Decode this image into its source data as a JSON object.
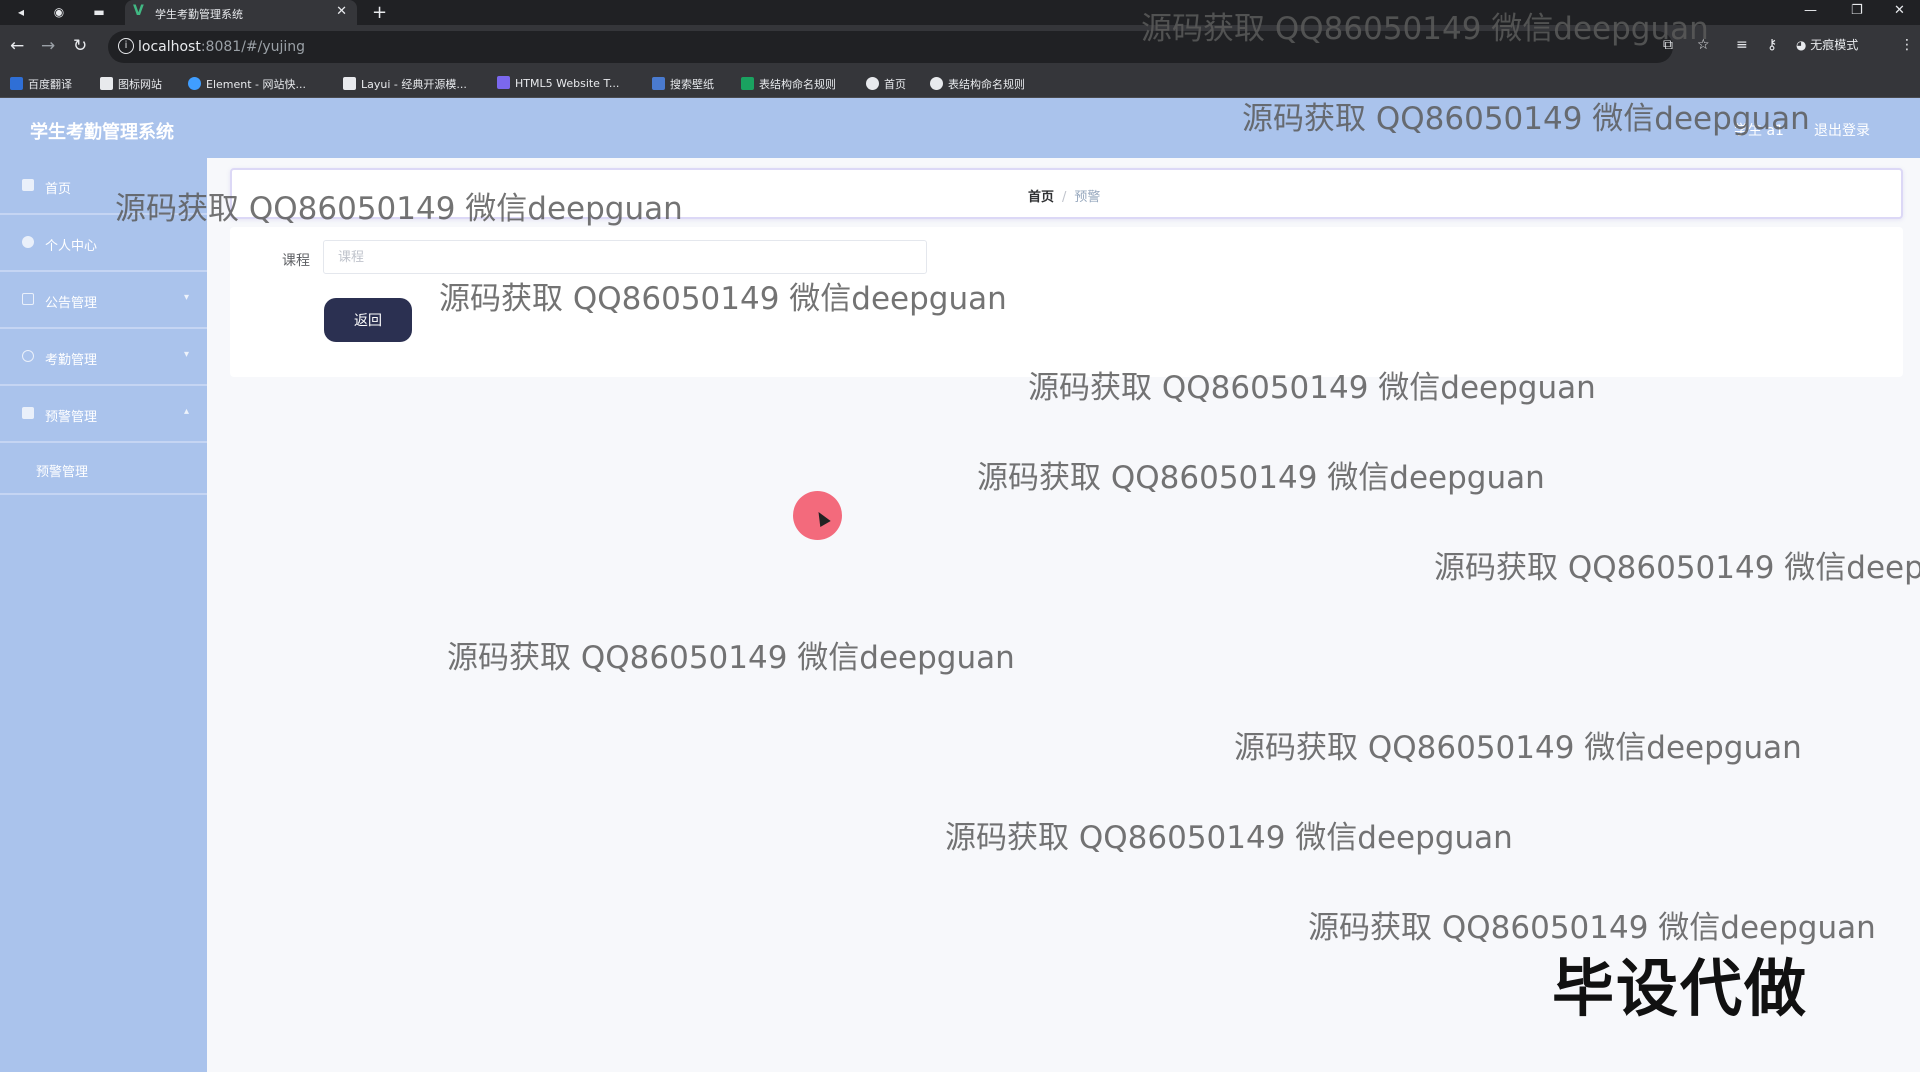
{
  "browser": {
    "tab_title": "学生考勤管理系统",
    "url_host": "localhost",
    "url_path": ":8081/#/yujing",
    "incognito_label": "无痕模式",
    "bookmarks": [
      {
        "label": "百度翻译",
        "color": "#2f6fd6"
      },
      {
        "label": "图标网站",
        "color": "#e8eaed"
      },
      {
        "label": "Element - 网站快...",
        "color": "#409eff"
      },
      {
        "label": "Layui - 经典开源模...",
        "color": "#e8eaed"
      },
      {
        "label": "HTML5 Website T...",
        "color": "#7b68ee"
      },
      {
        "label": "搜索壁纸",
        "color": "#4a7bd0"
      },
      {
        "label": "表结构命名规则",
        "color": "#1aa260"
      },
      {
        "label": "首页",
        "color": "#e8eaed"
      },
      {
        "label": "表结构命名规则",
        "color": "#e8eaed"
      }
    ]
  },
  "header": {
    "title": "学生考勤管理系统",
    "user": "学生 a1",
    "logout": "退出登录"
  },
  "sidebar": {
    "items": [
      {
        "label": "首页",
        "icon": "home-icon"
      },
      {
        "label": "个人中心",
        "icon": "user-icon"
      },
      {
        "label": "公告管理",
        "icon": "notice-icon"
      },
      {
        "label": "考勤管理",
        "icon": "attendance-icon"
      },
      {
        "label": "预警管理",
        "icon": "warning-icon"
      }
    ],
    "sub_items": [
      {
        "label": "预警管理"
      }
    ]
  },
  "breadcrumb": {
    "home": "首页",
    "separator": "/",
    "current": "预警"
  },
  "form": {
    "course_label": "课程",
    "course_placeholder": "课程",
    "course_value": "",
    "back_button": "返回"
  },
  "overlay": {
    "watermark_text": "源码获取 QQ86050149 微信deepguan",
    "stamp_text": "毕设代做"
  },
  "colors": {
    "accent": "#aac3ec",
    "button": "#2b3051",
    "cursor_highlight": "#f25a6e"
  }
}
